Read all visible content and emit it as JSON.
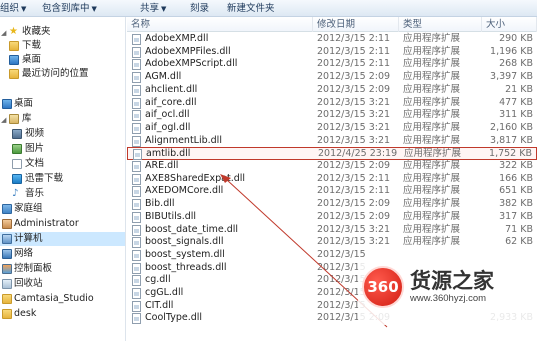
{
  "toolbar": {
    "organize": "组织",
    "include_library": "包含到库中",
    "share": "共享",
    "burn": "刻录",
    "new_folder": "新建文件夹"
  },
  "nav": {
    "favorites": "收藏夹",
    "downloads": "下载",
    "desktop": "桌面",
    "recent": "最近访问的位置",
    "desktop_root": "桌面",
    "libraries": "库",
    "videos": "视频",
    "pictures": "图片",
    "documents": "文档",
    "thunder": "迅雷下载",
    "music": "音乐",
    "homegroup": "家庭组",
    "administrator": "Administrator",
    "computer": "计算机",
    "network": "网络",
    "control_panel": "控制面板",
    "recycle_bin": "回收站",
    "camtasia": "Camtasia_Studio",
    "desk": "desk"
  },
  "columns": {
    "name": "名称",
    "date": "修改日期",
    "type": "类型",
    "size": "大小"
  },
  "files": [
    {
      "name": "AdobeXMP.dll",
      "date": "2012/3/15 2:11",
      "type": "应用程序扩展",
      "size": "290 KB"
    },
    {
      "name": "AdobeXMPFiles.dll",
      "date": "2012/3/15 2:11",
      "type": "应用程序扩展",
      "size": "1,196 KB"
    },
    {
      "name": "AdobeXMPScript.dll",
      "date": "2012/3/15 2:11",
      "type": "应用程序扩展",
      "size": "268 KB"
    },
    {
      "name": "AGM.dll",
      "date": "2012/3/15 2:09",
      "type": "应用程序扩展",
      "size": "3,397 KB"
    },
    {
      "name": "ahclient.dll",
      "date": "2012/3/15 2:09",
      "type": "应用程序扩展",
      "size": "21 KB"
    },
    {
      "name": "aif_core.dll",
      "date": "2012/3/15 3:21",
      "type": "应用程序扩展",
      "size": "477 KB"
    },
    {
      "name": "aif_ocl.dll",
      "date": "2012/3/15 3:21",
      "type": "应用程序扩展",
      "size": "311 KB"
    },
    {
      "name": "aif_ogl.dll",
      "date": "2012/3/15 3:21",
      "type": "应用程序扩展",
      "size": "2,160 KB"
    },
    {
      "name": "AlignmentLib.dll",
      "date": "2012/3/15 3:21",
      "type": "应用程序扩展",
      "size": "3,817 KB"
    },
    {
      "name": "amtlib.dll",
      "date": "2012/4/25 23:19",
      "type": "应用程序扩展",
      "size": "1,752 KB",
      "highlight": true
    },
    {
      "name": "ARE.dll",
      "date": "2012/3/15 2:09",
      "type": "应用程序扩展",
      "size": "322 KB"
    },
    {
      "name": "AXE8SharedExpat.dll",
      "date": "2012/3/15 2:11",
      "type": "应用程序扩展",
      "size": "166 KB"
    },
    {
      "name": "AXEDOMCore.dll",
      "date": "2012/3/15 2:11",
      "type": "应用程序扩展",
      "size": "651 KB"
    },
    {
      "name": "Bib.dll",
      "date": "2012/3/15 2:09",
      "type": "应用程序扩展",
      "size": "382 KB"
    },
    {
      "name": "BIBUtils.dll",
      "date": "2012/3/15 2:09",
      "type": "应用程序扩展",
      "size": "317 KB"
    },
    {
      "name": "boost_date_time.dll",
      "date": "2012/3/15 3:21",
      "type": "应用程序扩展",
      "size": "71 KB"
    },
    {
      "name": "boost_signals.dll",
      "date": "2012/3/15 3:21",
      "type": "应用程序扩展",
      "size": "62 KB"
    },
    {
      "name": "boost_system.dll",
      "date": "2012/3/15",
      "type": "",
      "size": ""
    },
    {
      "name": "boost_threads.dll",
      "date": "2012/3/15",
      "type": "",
      "size": ""
    },
    {
      "name": "cg.dll",
      "date": "2012/3/15",
      "type": "",
      "size": ""
    },
    {
      "name": "cgGL.dll",
      "date": "2012/3/15",
      "type": "",
      "size": ""
    },
    {
      "name": "CIT.dll",
      "date": "2012/3/15",
      "type": "",
      "size": ""
    },
    {
      "name": "CoolType.dll",
      "date": "2012/3/15 2:09",
      "type": "",
      "size": "2,933 KB"
    }
  ],
  "watermark": {
    "logo": "360",
    "title": "货源之家",
    "url": "www.360hyzj.com"
  },
  "colors": {
    "highlight_border": "#c0392b",
    "arrow": "#c0392b",
    "logo": "#e3251b"
  }
}
